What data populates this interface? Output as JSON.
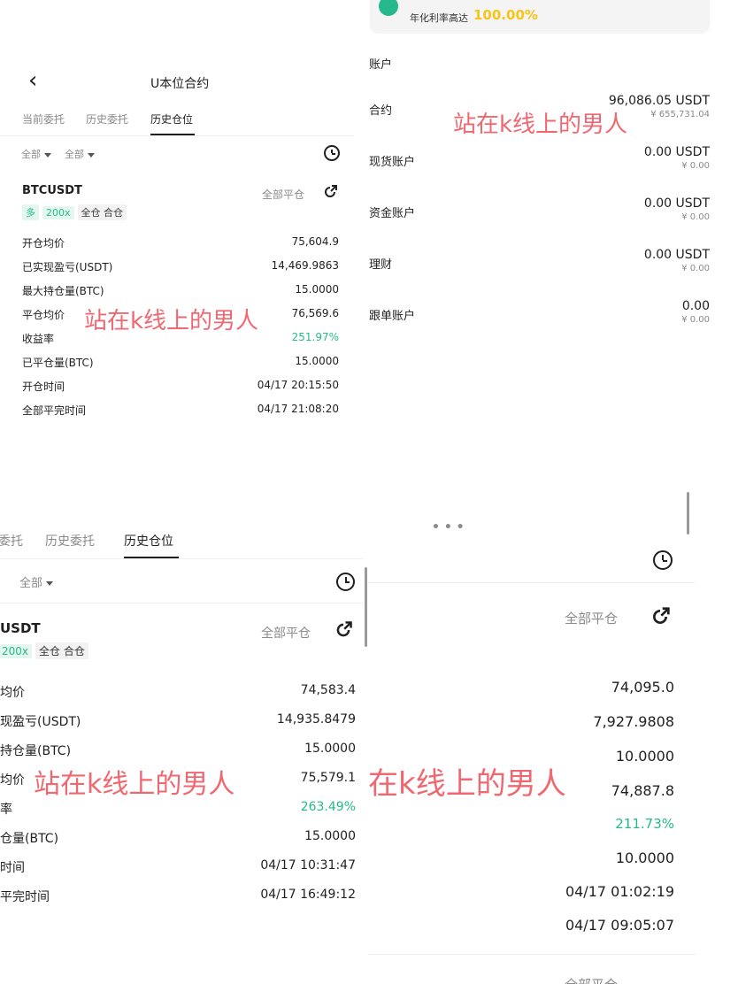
{
  "p1": {
    "title": "U本位合约",
    "back": "‹",
    "tabs": [
      "当前委托",
      "历史委托",
      "历史仓位"
    ],
    "filters": [
      "全部",
      "全部"
    ],
    "symbol": "BTCUSDT",
    "tags": [
      "多",
      "200x",
      "全仓 合仓"
    ],
    "close_all": "全部平仓",
    "rows": [
      {
        "label": "开仓均价",
        "value": "75,604.9"
      },
      {
        "label": "已实现盈亏(USDT)",
        "value": "14,469.9863"
      },
      {
        "label": "最大持仓量(BTC)",
        "value": "15.0000"
      },
      {
        "label": "平仓均价",
        "value": "76,569.6"
      },
      {
        "label": "收益率",
        "value": "251.97%"
      },
      {
        "label": "已平仓量(BTC)",
        "value": "15.0000"
      },
      {
        "label": "开仓时间",
        "value": "04/17 20:15:50"
      },
      {
        "label": "全部平完时间",
        "value": "04/17 21:08:20"
      }
    ],
    "watermark": "站在k线上的男人"
  },
  "p2": {
    "banner_text": "年化利率高达",
    "banner_rate": "100.00%",
    "section": "账户",
    "accounts": [
      {
        "name": "合约",
        "value": "96,086.05 USDT",
        "sub": "¥ 655,731.04"
      },
      {
        "name": "现货账户",
        "value": "0.00 USDT",
        "sub": "¥ 0.00"
      },
      {
        "name": "资金账户",
        "value": "0.00 USDT",
        "sub": "¥ 0.00"
      },
      {
        "name": "理财",
        "value": "0.00 USDT",
        "sub": "¥ 0.00"
      },
      {
        "name": "跟单账户",
        "value": "0.00",
        "sub": "¥ 0.00"
      }
    ],
    "watermark": "站在k线上的男人"
  },
  "p3": {
    "tabs": [
      "委托",
      "历史委托",
      "历史仓位"
    ],
    "filter": "全部",
    "symbol": "USDT",
    "tags": [
      "200x",
      "全仓 合仓"
    ],
    "close_all": "全部平仓",
    "rows": [
      {
        "label": "均价",
        "value": "74,583.4"
      },
      {
        "label": "现盈亏(USDT)",
        "value": "14,935.8479"
      },
      {
        "label": "持仓量(BTC)",
        "value": "15.0000"
      },
      {
        "label": "均价",
        "value": "75,579.1"
      },
      {
        "label": "率",
        "value": "263.49%"
      },
      {
        "label": "仓量(BTC)",
        "value": "15.0000"
      },
      {
        "label": "时间",
        "value": "04/17 10:31:47"
      },
      {
        "label": "平完时间",
        "value": "04/17 16:49:12"
      }
    ],
    "watermark": "站在k线上的男人"
  },
  "p4": {
    "dots": "• • •",
    "close_all": "全部平仓",
    "values": [
      "74,095.0",
      "7,927.9808",
      "10.0000",
      "74,887.8",
      "211.73%",
      "10.0000",
      "04/17 01:02:19",
      "04/17 09:05:07"
    ],
    "watermark": "在k线上的男人",
    "bottom_partial": "全部平仓"
  },
  "colors": {
    "green": "#26b98b",
    "watermark": "#ee4d58",
    "gold": "#f5c518"
  }
}
